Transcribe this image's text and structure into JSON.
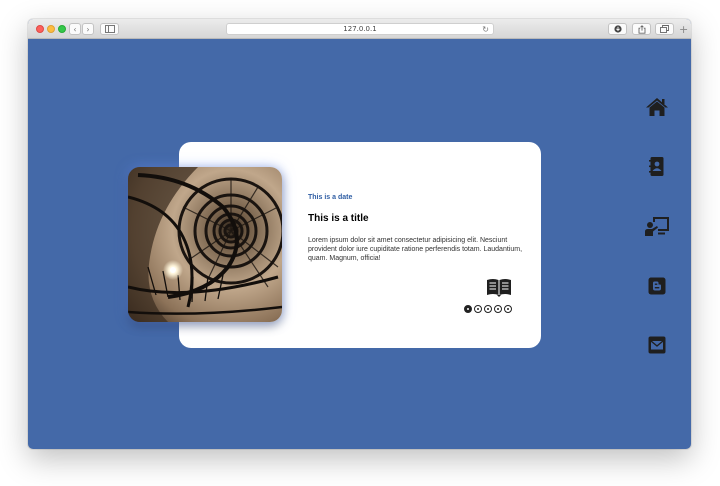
{
  "browser": {
    "url": "127.0.0.1",
    "reload_glyph": "↻",
    "back_glyph": "‹",
    "forward_glyph": "›",
    "new_tab_glyph": "+"
  },
  "card": {
    "date": "This is a date",
    "title": "This is a title",
    "text": "Lorem ipsum dolor sit amet consectetur adipisicing elit. Nesciunt provident dolor iure cupiditate ratione perferendis totam. Laudantium, quam. Magnum, officia!",
    "image": "spiral-staircase-photo",
    "read_icon": "book-open-icon",
    "slides_total": 5,
    "slide_active": 1
  },
  "side_nav": [
    {
      "icon": "home-icon"
    },
    {
      "icon": "contact-book-icon"
    },
    {
      "icon": "presentation-icon"
    },
    {
      "icon": "blogger-icon"
    },
    {
      "icon": "envelope-icon"
    }
  ],
  "colors": {
    "background": "#4469a8",
    "card": "#ffffff",
    "date_text": "#2f5ea4",
    "icon": "#1f1f1f"
  }
}
